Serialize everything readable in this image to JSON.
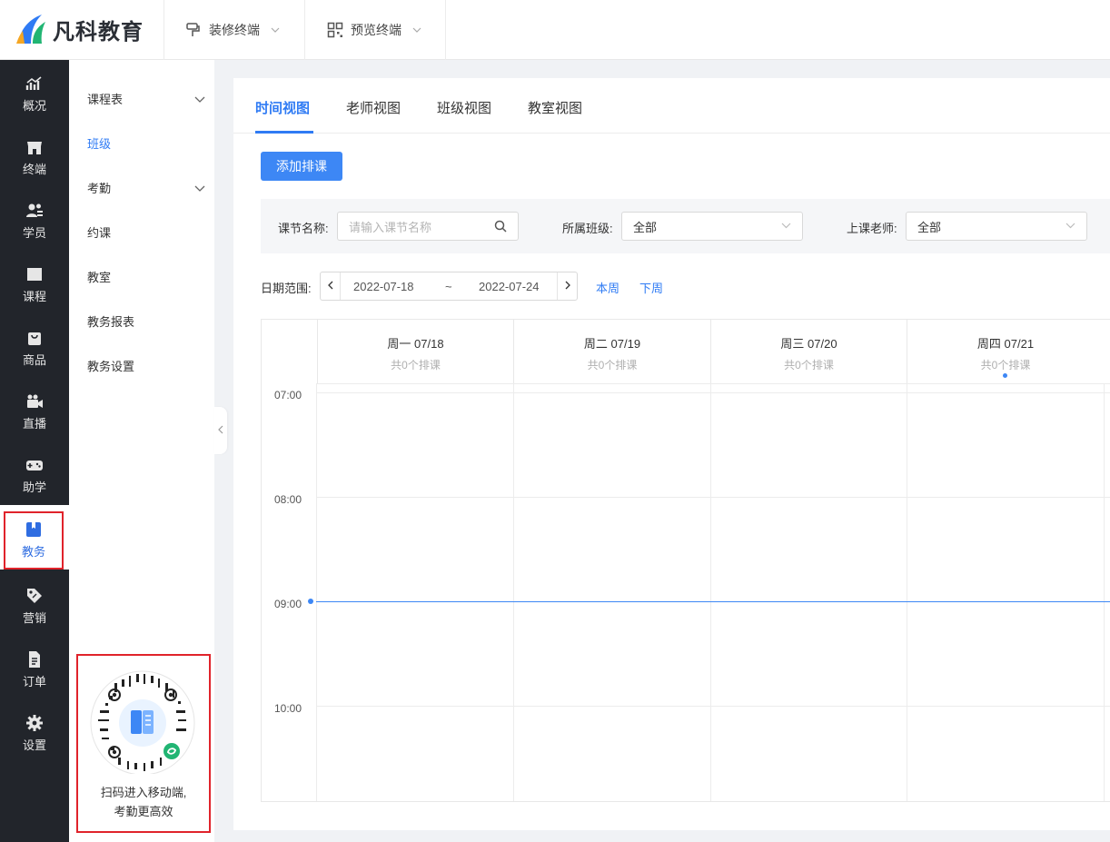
{
  "app": {
    "brand": "凡科教育"
  },
  "topbar": {
    "menus": [
      {
        "label": "装修终端",
        "icon": "paint-roller-icon"
      },
      {
        "label": "预览终端",
        "icon": "qrcode-icon"
      }
    ]
  },
  "sidebar": {
    "items": [
      {
        "label": "概况",
        "icon": "chart-icon"
      },
      {
        "label": "终端",
        "icon": "store-icon"
      },
      {
        "label": "学员",
        "icon": "students-icon"
      },
      {
        "label": "课程",
        "icon": "book-icon"
      },
      {
        "label": "商品",
        "icon": "bag-icon"
      },
      {
        "label": "直播",
        "icon": "video-icon"
      },
      {
        "label": "助学",
        "icon": "gamepad-icon"
      },
      {
        "label": "教务",
        "icon": "bookmark-icon",
        "active": true
      },
      {
        "label": "营销",
        "icon": "tag-icon"
      },
      {
        "label": "订单",
        "icon": "document-icon"
      },
      {
        "label": "设置",
        "icon": "gear-icon"
      }
    ],
    "active_color": "#2f6de1"
  },
  "submenu": {
    "items": [
      {
        "label": "课程表",
        "expandable": true
      },
      {
        "label": "班级",
        "active": true
      },
      {
        "label": "考勤",
        "expandable": true
      },
      {
        "label": "约课"
      },
      {
        "label": "教室"
      },
      {
        "label": "教务报表"
      },
      {
        "label": "教务设置"
      }
    ],
    "qr_caption_line1": "扫码进入移动端,",
    "qr_caption_line2": "考勤更高效"
  },
  "tabs": [
    {
      "label": "时间视图",
      "active": true
    },
    {
      "label": "老师视图"
    },
    {
      "label": "班级视图"
    },
    {
      "label": "教室视图"
    }
  ],
  "actions": {
    "add_schedule": "添加排课"
  },
  "filters": {
    "lesson_name_label": "课节名称:",
    "lesson_name_placeholder": "请输入课节名称",
    "class_label": "所属班级:",
    "class_value": "全部",
    "teacher_label": "上课老师:",
    "teacher_value": "全部"
  },
  "date_range": {
    "label": "日期范围:",
    "start": "2022-07-18",
    "separator": "~",
    "end": "2022-07-24",
    "this_week": "本周",
    "next_week": "下周"
  },
  "calendar": {
    "days": [
      {
        "title": "周一 07/18",
        "sub": "共0个排课"
      },
      {
        "title": "周二 07/19",
        "sub": "共0个排课"
      },
      {
        "title": "周三 07/20",
        "sub": "共0个排课"
      },
      {
        "title": "周四 07/21",
        "sub": "共0个排课",
        "today": true
      }
    ],
    "times": [
      "07:00",
      "08:00",
      "09:00",
      "10:00"
    ]
  },
  "colors": {
    "primary": "#3d87f5",
    "sidebar_bg": "#22252b",
    "highlight_border": "#e0232b"
  }
}
